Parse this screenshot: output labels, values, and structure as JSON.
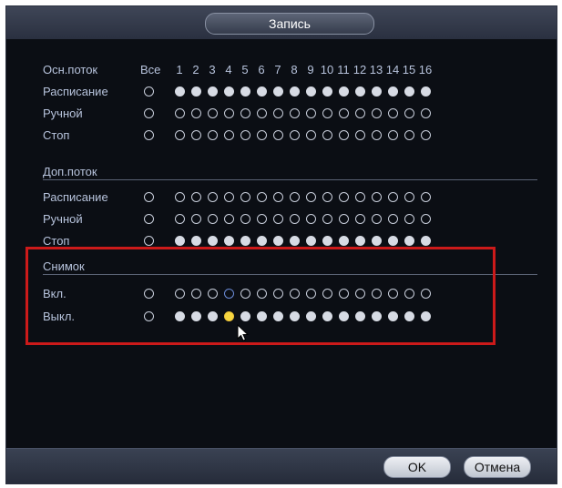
{
  "dialog": {
    "title": "Запись"
  },
  "header": {
    "label": "Осн.поток",
    "all": "Все",
    "channels": [
      "1",
      "2",
      "3",
      "4",
      "5",
      "6",
      "7",
      "8",
      "9",
      "10",
      "11",
      "12",
      "13",
      "14",
      "15",
      "16"
    ]
  },
  "main_stream": [
    {
      "label": "Расписание",
      "all_checked": false,
      "checked": [
        true,
        true,
        true,
        true,
        true,
        true,
        true,
        true,
        true,
        true,
        true,
        true,
        true,
        true,
        true,
        true
      ]
    },
    {
      "label": "Ручной",
      "all_checked": false,
      "checked": [
        false,
        false,
        false,
        false,
        false,
        false,
        false,
        false,
        false,
        false,
        false,
        false,
        false,
        false,
        false,
        false
      ]
    },
    {
      "label": "Стоп",
      "all_checked": false,
      "checked": [
        false,
        false,
        false,
        false,
        false,
        false,
        false,
        false,
        false,
        false,
        false,
        false,
        false,
        false,
        false,
        false
      ]
    }
  ],
  "sub_stream": {
    "title": "Доп.поток",
    "rows": [
      {
        "label": "Расписание",
        "all_checked": false,
        "checked": [
          false,
          false,
          false,
          false,
          false,
          false,
          false,
          false,
          false,
          false,
          false,
          false,
          false,
          false,
          false,
          false
        ]
      },
      {
        "label": "Ручной",
        "all_checked": false,
        "checked": [
          false,
          false,
          false,
          false,
          false,
          false,
          false,
          false,
          false,
          false,
          false,
          false,
          false,
          false,
          false,
          false
        ]
      },
      {
        "label": "Стоп",
        "all_checked": false,
        "checked": [
          true,
          true,
          true,
          true,
          true,
          true,
          true,
          true,
          true,
          true,
          true,
          true,
          true,
          true,
          true,
          true
        ]
      }
    ]
  },
  "snapshot": {
    "title": "Снимок",
    "rows": [
      {
        "label": "Вкл.",
        "all_checked": false,
        "checked": [
          false,
          false,
          false,
          false,
          false,
          false,
          false,
          false,
          false,
          false,
          false,
          false,
          false,
          false,
          false,
          false
        ]
      },
      {
        "label": "Выкл.",
        "all_checked": false,
        "checked": [
          true,
          true,
          true,
          true,
          true,
          true,
          true,
          true,
          true,
          true,
          true,
          true,
          true,
          true,
          true,
          true
        ]
      }
    ]
  },
  "highlight_channel": "4",
  "colors": {
    "highlight_box": "#cc1a1a",
    "hover_dot": "#f6d640"
  },
  "footer": {
    "ok": "OK",
    "cancel": "Отмена"
  }
}
